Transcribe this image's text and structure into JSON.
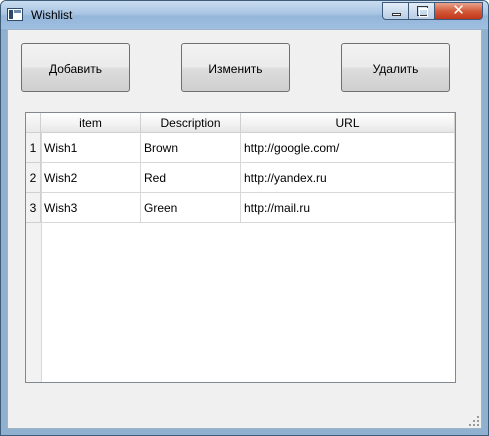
{
  "window": {
    "title": "Wishlist",
    "close_symbol": "✕",
    "icons": {
      "app": "app-window-icon",
      "minimize": "minimize-icon",
      "maximize": "maximize-icon",
      "close": "close-icon"
    }
  },
  "toolbar": {
    "add_label": "Добавить",
    "edit_label": "Изменить",
    "delete_label": "Удалить"
  },
  "table": {
    "columns": [
      "item",
      "Description",
      "URL"
    ],
    "rows": [
      {
        "num": "1",
        "item": "Wish1",
        "description": "Brown",
        "url": "http://google.com/"
      },
      {
        "num": "2",
        "item": "Wish2",
        "description": "Red",
        "url": "http://yandex.ru"
      },
      {
        "num": "3",
        "item": "Wish3",
        "description": "Green",
        "url": "http://mail.ru"
      }
    ]
  },
  "colors": {
    "close_button": "#c2361a",
    "titlebar": "#a9c5e3",
    "client_bg": "#f0f0f0"
  }
}
